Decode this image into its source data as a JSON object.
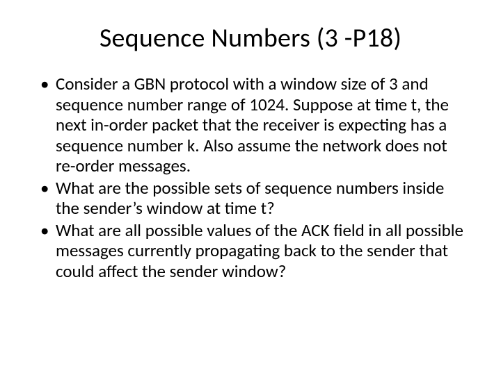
{
  "slide": {
    "title": "Sequence Numbers (3 -P18)",
    "bullets": [
      "Consider a GBN protocol with a window size of 3 and sequence number range of 1024. Suppose at time t, the next in-order packet that the receiver is expecting has a sequence number k. Also assume the network does not re-order messages.",
      "What are the possible sets of sequence numbers inside the sender’s window at time t?",
      "What are all possible values of the ACK field in all possible messages currently propagating back to the sender that could affect the sender window?"
    ]
  }
}
